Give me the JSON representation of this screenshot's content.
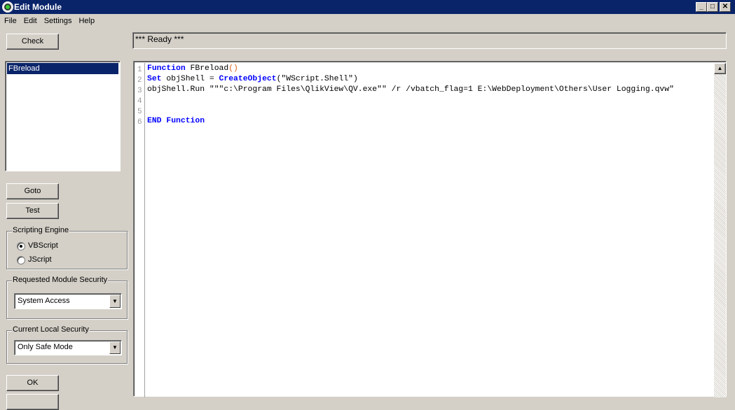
{
  "window": {
    "title": "Edit Module",
    "minimize": "_",
    "maximize": "□",
    "close": "✕"
  },
  "menu": [
    "File",
    "Edit",
    "Settings",
    "Help"
  ],
  "buttons": {
    "check": "Check",
    "goto": "Goto",
    "test": "Test",
    "ok": "OK"
  },
  "status": "*** Ready ***",
  "modules": [
    "FBreload"
  ],
  "scripting_engine": {
    "label": "Scripting Engine",
    "options": [
      "VBScript",
      "JScript"
    ],
    "selected": "VBScript"
  },
  "requested_security": {
    "label": "Requested Module Security",
    "value": "System Access"
  },
  "local_security": {
    "label": "Current Local Security",
    "value": "Only Safe Mode"
  },
  "editor": {
    "line_numbers": [
      "1",
      "2",
      "3",
      "4",
      "5",
      "6"
    ],
    "lines": [
      [
        {
          "t": "Function",
          "k": true
        },
        {
          "t": " FBreload"
        },
        {
          "t": "()",
          "c": "#e06010"
        }
      ],
      [
        {
          "t": "Set",
          "k": true
        },
        {
          "t": " objShell = "
        },
        {
          "t": "CreateObject",
          "k": true
        },
        {
          "t": "(\"WScript.Shell\")"
        }
      ],
      [
        {
          "t": "objShell.Run \"\"\"c:\\Program Files\\QlikView\\QV.exe\"\" /r /vbatch_flag=1 E:\\WebDeployment\\Others\\User Logging.qvw\""
        }
      ],
      [],
      [],
      [
        {
          "t": "END",
          "k": true
        },
        {
          "t": " "
        },
        {
          "t": "Function",
          "k": true
        }
      ]
    ]
  },
  "colors": {
    "titlebar": "#0a246a",
    "keyword": "#0000ff",
    "selection": "#0a246a"
  }
}
